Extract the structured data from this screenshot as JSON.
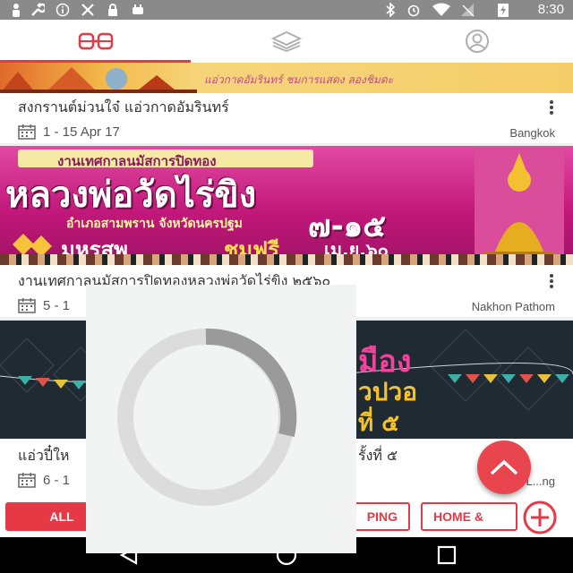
{
  "status_bar": {
    "time": "8:30"
  },
  "top_tabs": [
    {
      "icon": "events-glasses-icon",
      "active": true
    },
    {
      "icon": "layers-icon",
      "active": false
    },
    {
      "icon": "profile-icon",
      "active": false
    }
  ],
  "banner_top": {
    "text": "แอ่วกาดอัมรินทร์   ชมการแสดง   ลองชิมดะ"
  },
  "events": [
    {
      "title": "สงกรานต์ม่วนใจ๋ แอ่วกาดอัมรินทร์",
      "date": "1 - 15 Apr 17",
      "location": "Bangkok"
    },
    {
      "banner_line1": "งานเทศกาลนมัสการปิดทอง",
      "banner_line2": "หลวงพ่อวัดไร่ขิง",
      "banner_line3": "อำเภอสามพราน  จังหวัดนครปฐม",
      "banner_line4": "มหรสพ",
      "banner_line4b": "ชมฟรี",
      "banner_dates": "๗-๑๕",
      "banner_month": "เม.ย.๖๐",
      "title": "งานเทศกาลนมัสการปิดทองหลวงพ่อวัดไร่ขิง ๒๕๖๐",
      "date": "5 - 1",
      "location": "Nakhon Pathom"
    },
    {
      "banner_line1": "มือง",
      "banner_line2": "วปวอ",
      "banner_line3": "ที่ ๕",
      "title_left": "แอ่วปี๋ให",
      "title_right": "รั้งที่ ๕",
      "date": "6 - 1",
      "location": "L...ng"
    }
  ],
  "filters": [
    {
      "label": "ALL",
      "active": true
    },
    {
      "label": "PING",
      "active": false
    },
    {
      "label": "HOME &",
      "active": false
    }
  ],
  "colors": {
    "accent": "#e53945",
    "status_bar": "#8a8a8a",
    "nav_bar": "#000000",
    "magenta_banner": "#c2187a",
    "dark_banner": "#1f2a33"
  }
}
